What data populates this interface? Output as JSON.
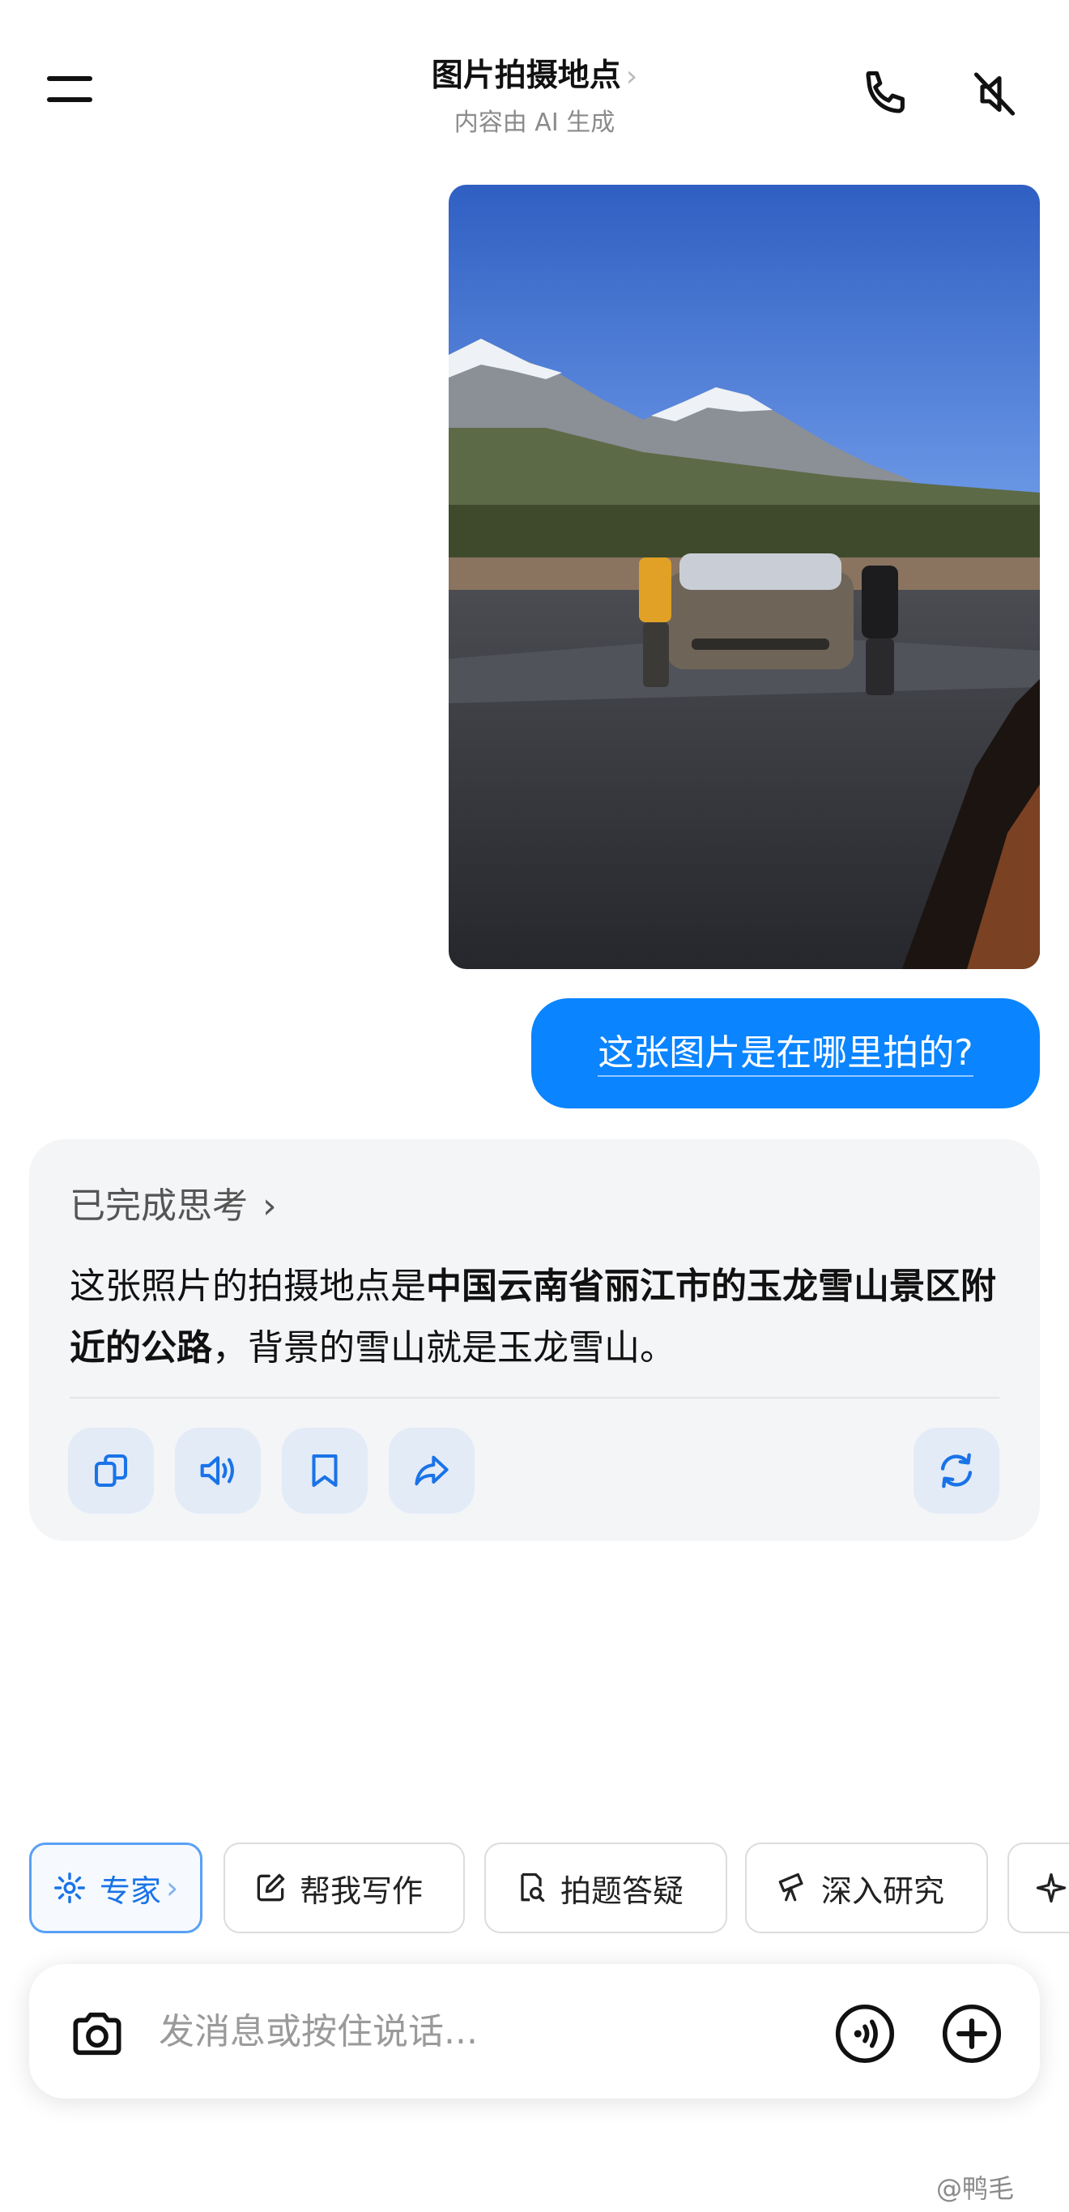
{
  "header": {
    "title": "图片拍摄地点",
    "title_chevron": "›",
    "subtitle": "内容由 AI 生成",
    "icons": [
      "menu-icon",
      "phone-icon",
      "mute-icon"
    ]
  },
  "conversation": {
    "user_image": "photo of a car on a mountain road with snowy mountains",
    "user_message": "这张图片是在哪里拍的?",
    "answer": {
      "thinking_label": "已完成思考",
      "thinking_chevron": "›",
      "text_part1": "这张照片的拍摄地点是",
      "text_bold": "中国云南省丽江市的玉龙雪山景区附近的公路",
      "text_part2": "，背景的雪山就是玉龙雪山。",
      "actions": [
        "copy-icon",
        "speaker-icon",
        "bookmark-icon",
        "share-icon",
        "refresh-icon"
      ]
    }
  },
  "quick_actions": {
    "expert": "专家",
    "expert_chevron": "›",
    "write": "帮我写作",
    "solve": "拍题答疑",
    "research": "深入研究"
  },
  "input": {
    "placeholder": "发消息或按住说话..."
  },
  "watermark": "@鸭毛",
  "colors": {
    "accent": "#0a84ff",
    "card_bg": "#f4f5f7",
    "action_btn_bg": "#e3ebf7",
    "icon_blue": "#1a73e8"
  }
}
